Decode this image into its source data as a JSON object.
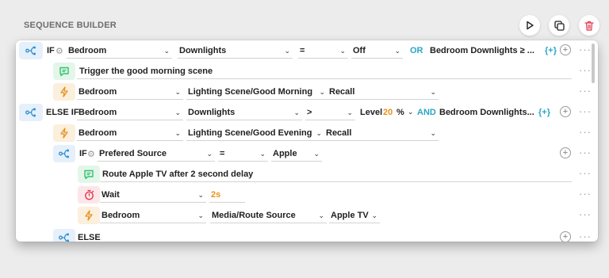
{
  "title": "SEQUENCE BUILDER",
  "toolbar": {
    "play_icon": "play-icon",
    "copy_icon": "copy-icon",
    "delete_icon": "trash-icon"
  },
  "colors": {
    "teal": "#2aa6c7",
    "orange": "#e8911c",
    "green": "#2ec36a",
    "red": "#e23a4e",
    "blue": "#2d8fd1"
  },
  "rows": {
    "if1": {
      "kw": "IF",
      "room": "Bedroom",
      "device": "Downlights",
      "op": "=",
      "value": "Off",
      "joiner": "OR",
      "extra": "Bedroom Downlights ≥ ...",
      "add": "{+}"
    },
    "msg1": {
      "text": "Trigger the good morning scene"
    },
    "act1": {
      "room": "Bedroom",
      "scene": "Lighting Scene/Good Morning",
      "action": "Recall"
    },
    "elseif": {
      "kw": "ELSE IF",
      "room": "Bedroom",
      "device": "Downlights",
      "op": ">",
      "level_label": "Level",
      "level_value": "20",
      "unit": "%",
      "joiner": "AND",
      "extra": "Bedroom Downlights...",
      "add": "{+}"
    },
    "act2": {
      "room": "Bedroom",
      "scene": "Lighting Scene/Good Evening",
      "action": "Recall"
    },
    "if2": {
      "kw": "IF",
      "source": "Prefered Source",
      "op": "=",
      "value": "Apple"
    },
    "msg2": {
      "text": "Route Apple TV after 2 second delay"
    },
    "wait": {
      "label": "Wait",
      "value": "2s"
    },
    "act3": {
      "room": "Bedroom",
      "target": "Media/Route Source",
      "value": "Apple TV"
    },
    "else": {
      "kw": "ELSE"
    }
  }
}
